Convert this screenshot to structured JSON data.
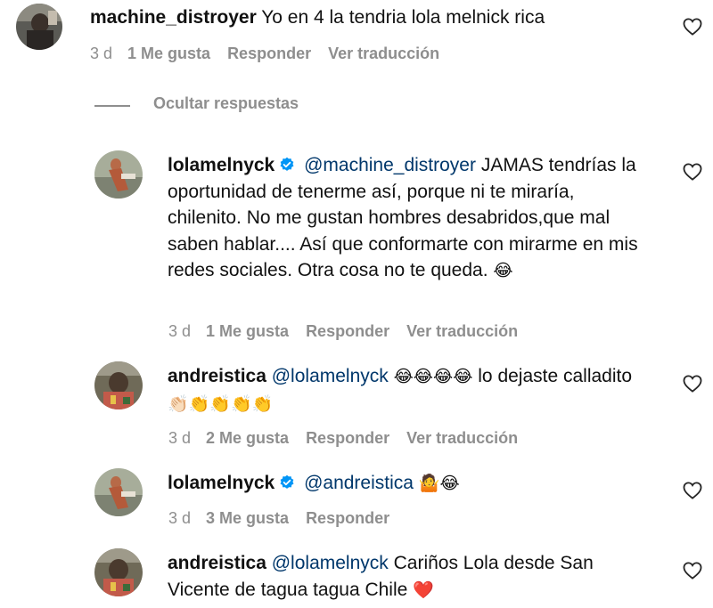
{
  "comments": [
    {
      "username": "machine_distroyer",
      "verified": false,
      "mention": "",
      "text": "Yo en 4 la tendria lola melnick rica",
      "time": "3 d",
      "likes": "1 Me gusta",
      "reply": "Responder",
      "translate": "Ver traducción"
    },
    {
      "username": "lolamelnyck",
      "verified": true,
      "mention": "@machine_distroyer",
      "text": "JAMAS tendrías la oportunidad de tenerme así, porque ni te miraría, chilenito. No me gustan hombres desabridos,que mal saben hablar.... Así que conformarte con mirarme en mis redes sociales. Otra cosa no te queda.",
      "emoji": "😂",
      "time": "3 d",
      "likes": "1 Me gusta",
      "reply": "Responder",
      "translate": "Ver traducción"
    },
    {
      "username": "andreistica",
      "verified": false,
      "mention": "@lolamelnyck",
      "emoji_a": "😂😂😂😂",
      "text": "lo dejaste calladito",
      "emoji_b": "👏🏻👏👏👏👏",
      "time": "3 d",
      "likes": "2 Me gusta",
      "reply": "Responder",
      "translate": "Ver traducción"
    },
    {
      "username": "lolamelnyck",
      "verified": true,
      "mention": "@andreistica",
      "emoji": "🤷😂",
      "time": "3 d",
      "likes": "3 Me gusta",
      "reply": "Responder"
    },
    {
      "username": "andreistica",
      "verified": false,
      "mention": "@lolamelnyck",
      "text": "Cariños Lola desde San Vicente de tagua tagua Chile",
      "emoji": "❤️"
    }
  ],
  "hide_replies": "Ocultar respuestas",
  "colors": {
    "meta": "#8e8e8e",
    "mention": "#00376b",
    "verified": "#0095f6"
  },
  "icons": {
    "like": "heart-outline-icon",
    "verified": "verified-badge-icon"
  }
}
